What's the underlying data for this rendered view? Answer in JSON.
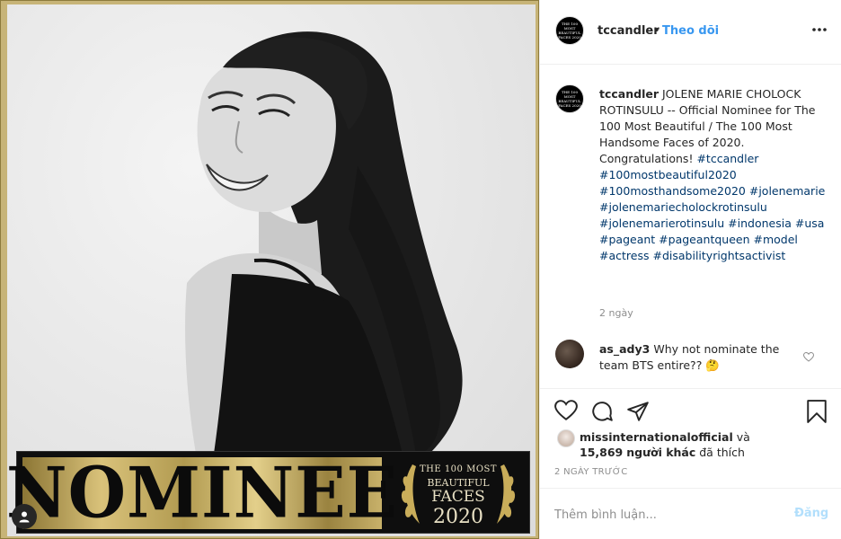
{
  "photo": {
    "banner": {
      "nominee_text": "NOMINEE",
      "badge_line1": "THE 100 MOST",
      "badge_line2": "BEAUTIFUL",
      "badge_line3": "FACES",
      "badge_line4": "2020"
    },
    "user_tag_icon": "user-silhouette-icon"
  },
  "header": {
    "avatar_text": "THE 100 MOST BEAUTIFUL FACES 2020",
    "username": "tccandler",
    "separator": "•",
    "follow_label": "Theo dõi",
    "more_icon": "more-horizontal-icon"
  },
  "caption": {
    "author": "tccandler",
    "text": "JOLENE MARIE CHOLOCK ROTINSULU -- Official Nominee for The 100 Most Beautiful / The 100 Most Handsome Faces of 2020. Congratulations!",
    "tags": [
      "#tccandler",
      "#100mostbeautiful2020",
      "#100mosthandsome2020",
      "#jolenemarie",
      "#jolenemariecholockrotinsulu",
      "#jolenemarierotinsulu",
      "#indonesia",
      "#usa",
      "#pageant",
      "#pageantqueen",
      "#model",
      "#actress",
      "#disabilityrightsactivist"
    ],
    "time": "2 ngày"
  },
  "comment": {
    "user": "as_ady3",
    "text": "Why not nominate the team BTS entire?? 🤔"
  },
  "actions": {
    "like_icon": "heart-icon",
    "comment_icon": "comment-icon",
    "share_icon": "share-icon",
    "save_icon": "bookmark-icon"
  },
  "likes": {
    "first_user": "missinternationalofficial",
    "and_label": "và",
    "count": "15,869",
    "others_label": "người khác",
    "suffix": "đã thích"
  },
  "post_date": "2 NGÀY TRƯỚC",
  "add_comment": {
    "placeholder": "Thêm bình luận...",
    "post_label": "Đăng"
  },
  "colors": {
    "link_blue": "#3897f0",
    "hashtag": "#00376b",
    "muted": "#8e8e8e",
    "post_disabled": "#b2dffc",
    "frame_gold": "#c7b478"
  }
}
